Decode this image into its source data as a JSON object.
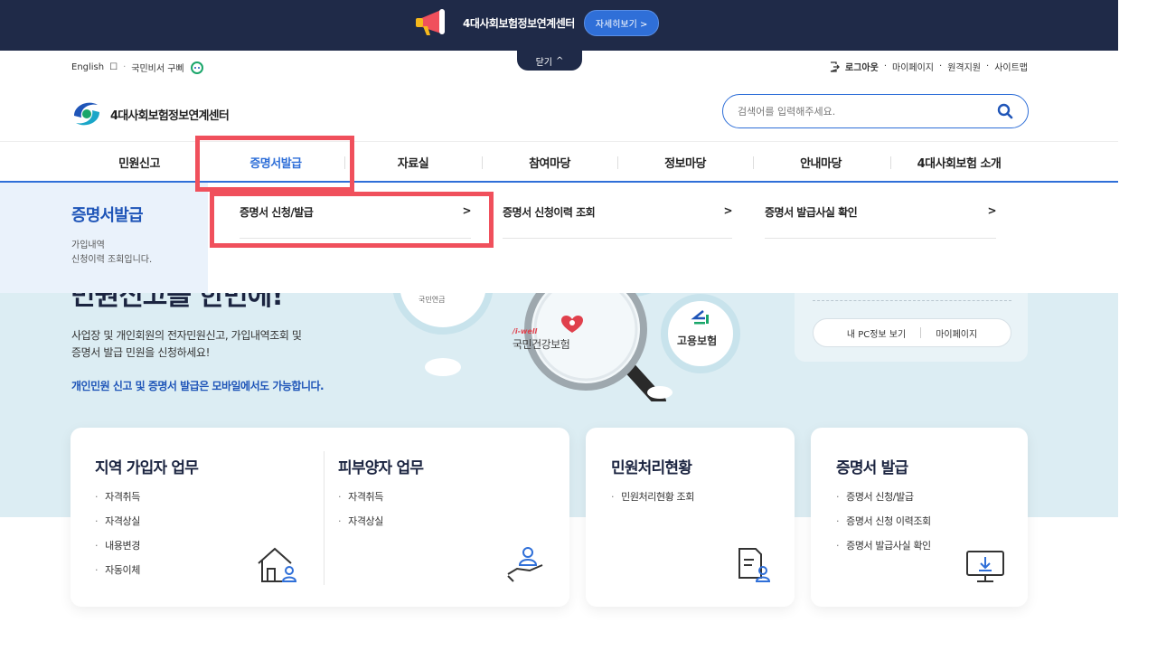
{
  "banner": {
    "title": "4대사회보험정보연계센터",
    "detail_label": "자세히보기 >",
    "close_label": "닫기"
  },
  "util": {
    "left": {
      "english": "English",
      "helper": "국민비서 구삐"
    },
    "right": {
      "logout": "로그아웃",
      "mypage": "마이페이지",
      "remote": "원격지원",
      "sitemap": "사이트맵"
    }
  },
  "logo": {
    "text": "4대사회보험정보연계센터"
  },
  "search": {
    "placeholder": "검색어를 입력해주세요."
  },
  "gnb": {
    "items": [
      "민원신고",
      "증명서발급",
      "자료실",
      "참여마당",
      "정보마당",
      "안내마당",
      "4대사회보험 소개"
    ],
    "active_index": 1
  },
  "dropdown": {
    "title": "증명서발급",
    "desc_line1": "가입내역",
    "desc_line2": "신청이력 조회입니다.",
    "links": [
      "증명서 신청/발급",
      "증명서 신청이력 조회",
      "증명서 발급사실 확인"
    ],
    "chevron": ">"
  },
  "hero": {
    "headline_cut": "민원신고를 한번에!",
    "desc_line1": "사업장 및 개인회원의 전자민원신고, 가입내역조회 및",
    "desc_line2": "증명서 발급 민원을 신청하세요!",
    "mobile_text": "개인민원 신고 및 증명서 발급은 모바일에서도 가능합니다.",
    "circle_labels": {
      "health": "국민건강보험",
      "health_brand": "/i-well",
      "employment": "고용보험",
      "pension_cut": "국민연금"
    },
    "side_btns": {
      "pcinfo": "내 PC정보 보기",
      "mypage": "마이페이지"
    }
  },
  "cards": {
    "regional": {
      "title": "지역 가입자 업무",
      "items": [
        "자격취득",
        "자격상실",
        "내용변경",
        "자동이체"
      ]
    },
    "dependent": {
      "title": "피부양자 업무",
      "items": [
        "자격취득",
        "자격상실"
      ]
    },
    "status": {
      "title": "민원처리현황",
      "items": [
        "민원처리현황 조회"
      ]
    },
    "cert": {
      "title": "증명서 발급",
      "items": [
        "증명서 신청/발급",
        "증명서 신청 이력조회",
        "증명서 발급사실 확인"
      ]
    }
  },
  "colors": {
    "navy": "#1f2a48",
    "accent": "#2f6fd8",
    "highlight": "#f0505c",
    "hero_bg": "#dcedf3"
  }
}
